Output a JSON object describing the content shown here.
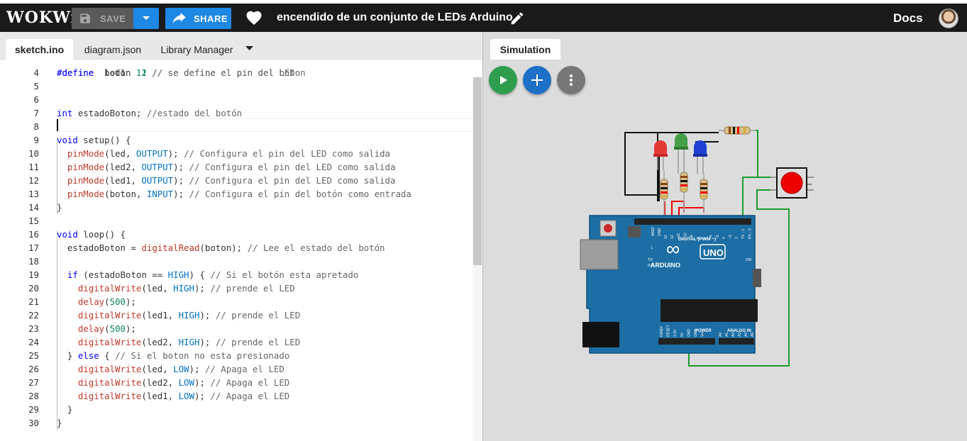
{
  "header": {
    "logo": "WOKWi",
    "save_label": "SAVE",
    "share_label": "SHARE",
    "project_title": "encendido de un conjunto de LEDs Arduino",
    "docs_label": "Docs"
  },
  "editor": {
    "tabs": [
      "sketch.ino",
      "diagram.json",
      "Library Manager"
    ],
    "active_tab": "sketch.ino",
    "partial_top_line": "#define  led1  11 // se define el pin del LED",
    "line_numbers": [
      "4",
      "5",
      "6",
      "7",
      "8",
      "9",
      "10",
      "11",
      "12",
      "13",
      "14",
      "15",
      "16",
      "17",
      "18",
      "19",
      "20",
      "21",
      "22",
      "23",
      "24",
      "25",
      "26",
      "27",
      "28",
      "29",
      "30"
    ],
    "lines": [
      "#define  boton  2 // se define el pin del boton",
      "",
      "",
      "int estadoBoton; //estado del botón",
      "",
      "void setup() {",
      "  pinMode(led, OUTPUT); // Configura el pin del LED como salida",
      "  pinMode(led2, OUTPUT); // Configura el pin del LED como salida",
      "  pinMode(led1, OUTPUT); // Configura el pin del LED como salida",
      "  pinMode(boton, INPUT); // Configura el pin del botón como entrada",
      "}",
      "",
      "void loop() {",
      "  estadoBoton = digitalRead(boton); // Lee el estado del botón",
      "",
      "  if (estadoBoton == HIGH) { // Si el botón esta apretado",
      "    digitalWrite(led, HIGH); // prende el LED",
      "    delay(500);",
      "    digitalWrite(led1, HIGH); // prende el LED",
      "    delay(500);",
      "    digitalWrite(led2, HIGH); // prende el LED",
      "  } else { // Si el boton no esta presionado",
      "    digitalWrite(led, LOW); // Apaga el LED",
      "    digitalWrite(led2, LOW); // Apaga el LED",
      "    digitalWrite(led1, LOW); // Apaga el LED",
      "  }",
      "}"
    ],
    "cursor_line": "8"
  },
  "simulation": {
    "tab_label": "Simulation",
    "board": {
      "logo_text": "ARDUINO",
      "model": "UNO",
      "digital_label": "DIGITAL (PWM ~)",
      "power_label": "POWER",
      "analog_label": "ANALOG IN",
      "on_label": "ON",
      "tx_label": "TX",
      "rx_label": "RX",
      "l_label": "L",
      "aref_label": "AREF",
      "gnd_label": "GND",
      "top_pins": [
        "13",
        "12",
        "~11",
        "~10",
        "~9",
        "8",
        "7",
        "~6",
        "~5",
        "4",
        "~3",
        "2",
        "TX→1",
        "RX←0"
      ],
      "power_pins": [
        "IOREF",
        "RESET",
        "3.3V",
        "5V",
        "GND",
        "GND",
        "Vin"
      ],
      "analog_pins": [
        "A0",
        "A1",
        "A2",
        "A3",
        "A4",
        "A5"
      ]
    },
    "led_colors": [
      "red",
      "green",
      "blue"
    ],
    "button_color": "red"
  },
  "colors": {
    "header_bg": "#1a1a1a",
    "accent_blue": "#1e88e5",
    "play_green": "#2e9e4e",
    "board_blue": "#1c6ea4"
  }
}
